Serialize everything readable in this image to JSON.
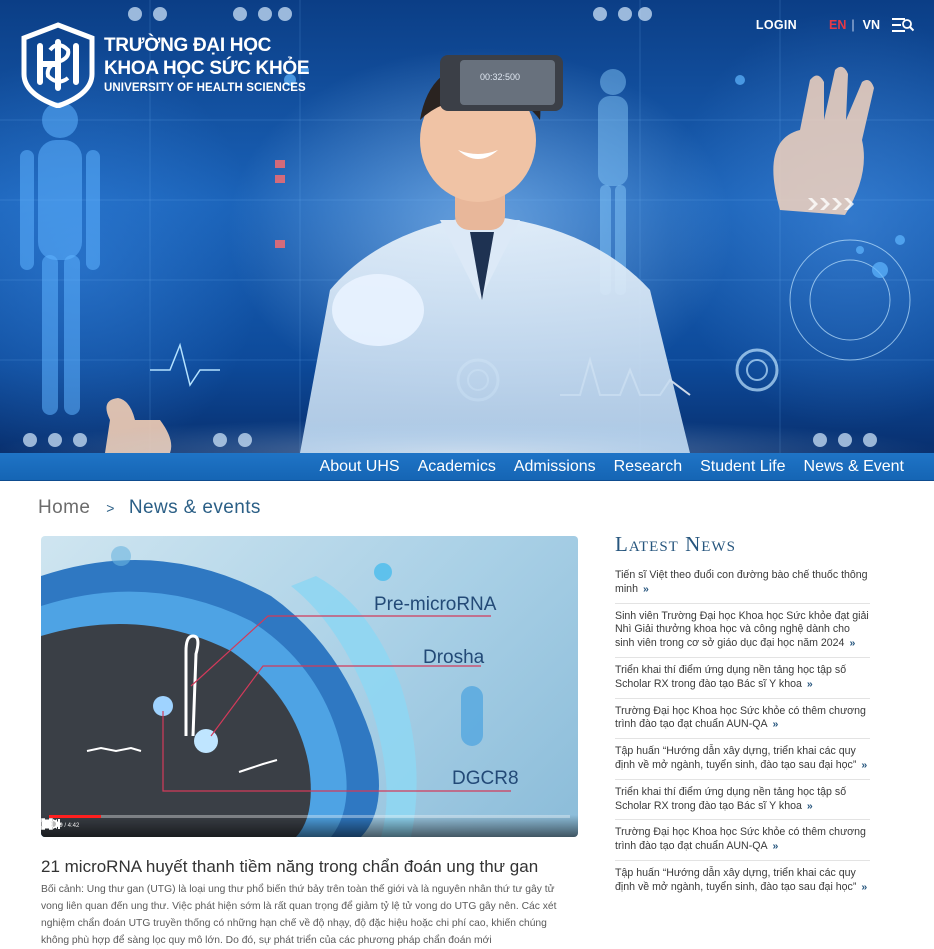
{
  "header": {
    "logo_line1": "TRƯỜNG ĐẠI HỌC",
    "logo_line2": "KHOA HỌC SỨC KHỎE",
    "logo_line3": "UNIVERSITY OF HEALTH SCIENCES",
    "login": "LOGIN",
    "lang_en": "EN",
    "lang_sep": "|",
    "lang_vn": "VN",
    "menu_icon": "menu-search-icon",
    "hero_readout": "00:32:500"
  },
  "nav": {
    "items": [
      "About UHS",
      "Academics",
      "Admissions",
      "Research",
      "Student Life",
      "News & Event"
    ]
  },
  "breadcrumb": {
    "home": "Home",
    "separator": ">",
    "current": "News & events"
  },
  "video": {
    "labels": [
      "Pre-microRNA",
      "Drosha",
      "DGCR8"
    ],
    "time": "0:29 / 4:42",
    "progress": 0.1
  },
  "article": {
    "title": "21 microRNA huyết thanh tiềm năng trong chẩn đoán ung thư gan",
    "body": "Bối cảnh: Ung thư gan (UTG) là loại ung thư phổ biến thứ bảy trên toàn thế giới và là nguyên nhân thứ tư gây tử vong liên quan đến ung thư. Việc phát hiện sớm là rất quan trọng để giảm tỷ lệ tử vong do UTG gây nên. Các xét nghiệm chẩn đoán UTG truyền thống có những hạn chế về độ nhạy, độ đặc hiệu hoặc chi phí cao, khiến chúng không phù hợp để sàng lọc quy mô lớn. Do đó, sự phát triển của các phương pháp chẩn đoán mới"
  },
  "sidebar": {
    "title": "Latest News",
    "arrow": "»",
    "items": [
      "Tiến sĩ Việt theo đuổi con đường bào chế thuốc thông minh",
      "Sinh viên Trường Đại học Khoa học Sức khỏe đạt giải Nhì Giải thưởng khoa học và công nghệ dành cho sinh viên trong cơ sở giáo dục đại học năm 2024",
      "Triển khai thí điểm ứng dụng nền tảng học tập số Scholar RX trong đào tạo Bác sĩ Y khoa",
      "Trường Đại học Khoa học Sức khỏe có thêm chương trình đào tạo đạt chuẩn AUN-QA",
      "Tập huấn “Hướng dẫn xây dựng, triển khai các quy định về mở ngành, tuyển sinh, đào tạo sau đại học”",
      "Triển khai thí điểm ứng dụng nền tảng học tập số Scholar RX trong đào tạo Bác sĩ Y khoa",
      "Trường Đại học Khoa học Sức khỏe có thêm chương trình đào tạo đạt chuẩn AUN-QA",
      "Tập huấn “Hướng dẫn xây dựng, triển khai các quy định về mở ngành, tuyển sinh, đào tạo sau đại học”"
    ]
  },
  "colors": {
    "nav_bg": "#1565b4",
    "accent_red": "#e63946",
    "heading_blue": "#27567e"
  }
}
